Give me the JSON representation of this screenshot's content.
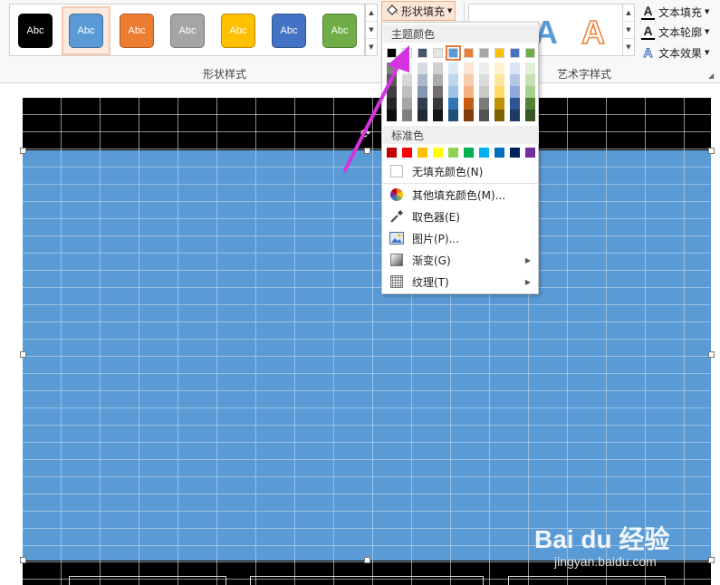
{
  "ribbon": {
    "shape_styles": [
      {
        "label": "Abc",
        "bg": "#000000",
        "border": "#000000"
      },
      {
        "label": "Abc",
        "bg": "#5b9bd5",
        "border": "#41719c"
      },
      {
        "label": "Abc",
        "bg": "#ed7d31",
        "border": "#ae5a21"
      },
      {
        "label": "Abc",
        "bg": "#a5a5a5",
        "border": "#787878"
      },
      {
        "label": "Abc",
        "bg": "#ffc000",
        "border": "#bc8c00"
      },
      {
        "label": "Abc",
        "bg": "#4472c4",
        "border": "#2f528f"
      },
      {
        "label": "Abc",
        "bg": "#70ad47",
        "border": "#507e32"
      }
    ],
    "shape_styles_label": "形状样式",
    "shape_fill_label": "形状填充",
    "wordart_label": "艺术字样式",
    "text_fill_label": "文本填充",
    "text_outline_label": "文本轮廓",
    "text_effects_label": "文本效果",
    "text_cmd_icon": "A"
  },
  "dropdown": {
    "theme_colors_header": "主题颜色",
    "theme_top_row": [
      "#000000",
      "#ffffff",
      "#44546a",
      "#e7e6e6",
      "#5b9bd5",
      "#ed7d31",
      "#a5a5a5",
      "#ffc000",
      "#4472c4",
      "#70ad47"
    ],
    "theme_shades": [
      [
        "#7f7f7f",
        "#595959",
        "#3f3f3f",
        "#262626",
        "#0c0c0c"
      ],
      [
        "#f2f2f2",
        "#d8d8d8",
        "#bfbfbf",
        "#a5a5a5",
        "#7f7f7f"
      ],
      [
        "#d6dce4",
        "#adb9ca",
        "#8496b0",
        "#333f50",
        "#222a35"
      ],
      [
        "#d0cece",
        "#aeabab",
        "#757070",
        "#3a3838",
        "#171616"
      ],
      [
        "#deebf6",
        "#bdd7ee",
        "#9dc3e6",
        "#2e75b5",
        "#1f4e79"
      ],
      [
        "#fbe5d5",
        "#f8cbad",
        "#f4b183",
        "#c55a11",
        "#833c0b"
      ],
      [
        "#ededed",
        "#dbdbdb",
        "#c9c9c9",
        "#7b7b7b",
        "#525252"
      ],
      [
        "#fff2cc",
        "#fee599",
        "#ffd965",
        "#bf9000",
        "#7f6000"
      ],
      [
        "#dae3f3",
        "#b4c7e7",
        "#8faadc",
        "#2f5496",
        "#203864"
      ],
      [
        "#e2efd9",
        "#c5e0b3",
        "#a8d08d",
        "#538135",
        "#375623"
      ]
    ],
    "standard_colors_header": "标准色",
    "standard_colors": [
      "#c00000",
      "#ff0000",
      "#ffc000",
      "#ffff00",
      "#92d050",
      "#00b050",
      "#00b0f0",
      "#0070c0",
      "#002060",
      "#7030a0"
    ],
    "no_fill_label": "无填充颜色(N)",
    "more_colors_label": "其他填充颜色(M)...",
    "eyedropper_label": "取色器(E)",
    "picture_label": "图片(P)...",
    "gradient_label": "渐变(G)",
    "texture_label": "纹理(T)"
  },
  "watermark": {
    "brand": "Bai du 经验",
    "url": "jingyan.baidu.com"
  },
  "colors": {
    "shape_fill": "#5b9bd5",
    "slide_bg": "#000000",
    "arrow": "#d633e0"
  }
}
